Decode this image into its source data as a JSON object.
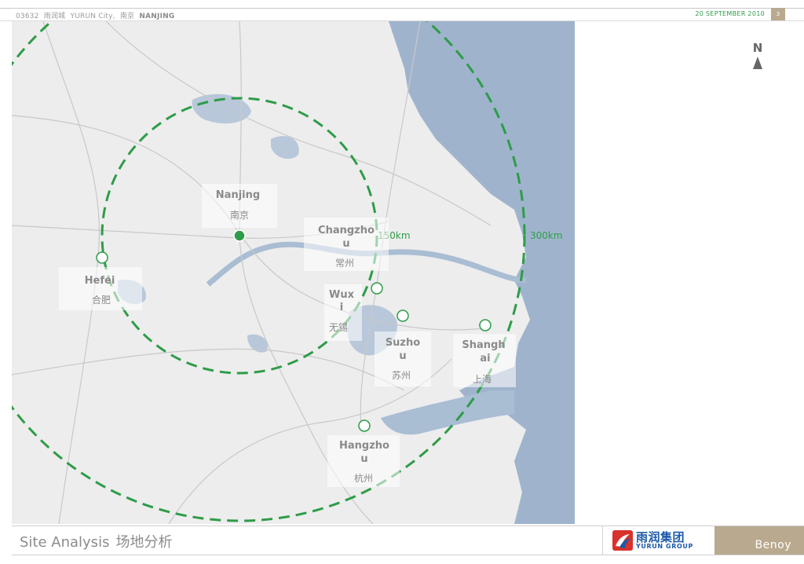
{
  "header": {
    "code": "03632",
    "project_cn": "雨润城",
    "project_en": "YURUN City,",
    "city_cn": "南京",
    "city_en": "NANJING",
    "date": "20 SEPTEMBER 2010",
    "page_number": "3"
  },
  "compass": {
    "label": "N"
  },
  "map": {
    "colors": {
      "land": "#ededed",
      "water": "#9fb4cc",
      "ring": "#2e9c48",
      "lake": "#b8c8da"
    },
    "rings": [
      {
        "label": "150km"
      },
      {
        "label": "300km"
      }
    ],
    "cities": [
      {
        "id": "nanjing",
        "en": "Nanjing",
        "cn": "南京",
        "marker": "filled"
      },
      {
        "id": "changzhou",
        "en_lines": [
          "Changzho",
          "u"
        ],
        "cn": "常州",
        "marker": "none"
      },
      {
        "id": "hefei",
        "en": "Hefei",
        "cn": "合肥",
        "marker": "open"
      },
      {
        "id": "wuxi",
        "en_lines": [
          "Wux",
          "i"
        ],
        "cn": "无锡",
        "marker": "open"
      },
      {
        "id": "suzhou",
        "en_lines": [
          "Suzho",
          "u"
        ],
        "cn": "苏州",
        "marker": "open"
      },
      {
        "id": "shanghai",
        "en_lines": [
          "Shangh",
          "ai"
        ],
        "cn": "上海",
        "marker": "open"
      },
      {
        "id": "hangzhou",
        "en_lines": [
          "Hangzho",
          "u"
        ],
        "cn": "杭州",
        "marker": "open"
      }
    ]
  },
  "footer": {
    "title_en": "Site Analysis",
    "title_cn": "场地分析",
    "logo_cn": "雨润集团",
    "logo_en": "YURUN GROUP",
    "brand": "Benoy"
  }
}
